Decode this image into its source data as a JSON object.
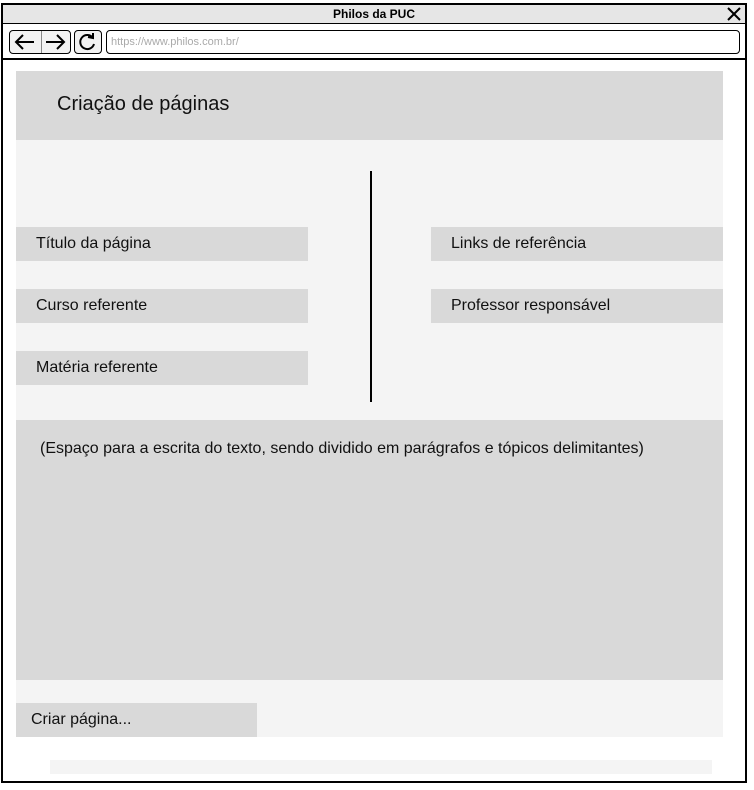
{
  "window": {
    "title": "Philos da PUC"
  },
  "toolbar": {
    "url": "https://www.philos.com.br/"
  },
  "icons": {
    "close": "close-icon",
    "back": "arrow-left-icon",
    "forward": "arrow-right-icon",
    "reload": "reload-icon"
  },
  "page": {
    "title": "Criação de páginas",
    "left_fields": [
      {
        "label": "Título da página"
      },
      {
        "label": "Curso referente"
      },
      {
        "label": "Matéria referente"
      }
    ],
    "right_fields": [
      {
        "label": "Links de referência"
      },
      {
        "label": "Professor responsável"
      }
    ],
    "text_area_placeholder": "(Espaço para a escrita do texto, sendo dividido em parágrafos e tópicos delimitantes)",
    "create_button": "Criar página..."
  },
  "colors": {
    "panel": "#d9d9d9",
    "background": "#f4f4f4",
    "border": "#000000"
  }
}
